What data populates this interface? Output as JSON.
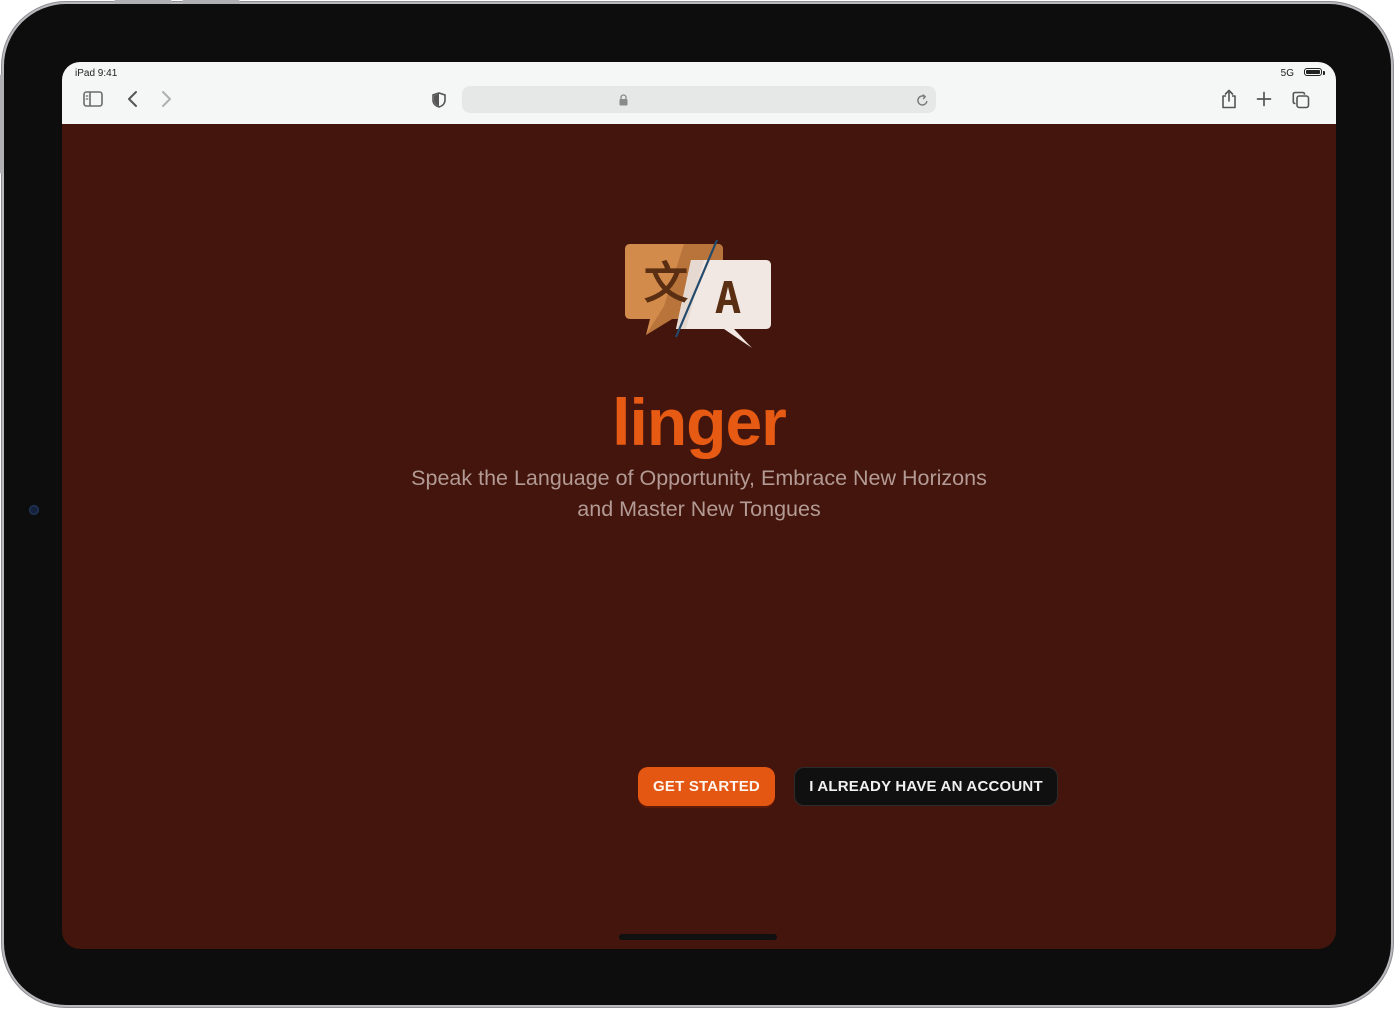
{
  "status_bar": {
    "time": "iPad 9:41",
    "signal": "5G"
  },
  "browser": {
    "icons": [
      "sidebar-icon",
      "back-icon",
      "forward-icon",
      "shield-icon",
      "lock-icon",
      "reload-icon",
      "share-icon",
      "new-tab-icon",
      "tabs-icon"
    ],
    "url": ""
  },
  "hero": {
    "logo": "translate-speech-bubbles-logo",
    "logo_glyph_left": "文",
    "logo_glyph_right": "A",
    "brand": "linger",
    "tagline_line1": "Speak the Language of Opportunity, Embrace New Horizons",
    "tagline_line2": "and Master New Tongues"
  },
  "actions": {
    "primary_label": "GET STARTED",
    "secondary_label": "I ALREADY HAVE AN ACCOUNT"
  },
  "colors": {
    "background": "#43150c",
    "accent": "#e75a13",
    "tagline": "#b39a94",
    "secondary_button": "#101010"
  }
}
